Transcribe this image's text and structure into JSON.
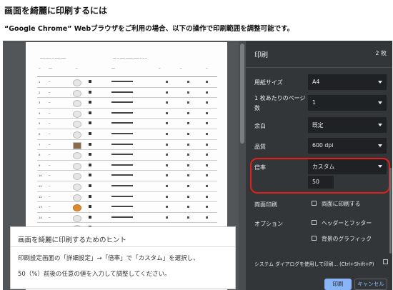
{
  "page": {
    "title": "画面を綺麗に印刷するには",
    "subtitle": "“Google Chrome” Webブラウザをご利用の場合、以下の操作で印刷範囲を調整可能です。"
  },
  "hint": {
    "title": "画面を綺麗に印刷するためのヒント",
    "line1": "印刷設定画面の「詳細設定」→「倍率」で「カスタム」を選択し、",
    "line2": "50（%）前後の任意の値を入力して調整してください。"
  },
  "print_panel": {
    "title": "印刷",
    "page_count": "2 枚",
    "settings": {
      "paper_size": {
        "label": "用紙サイズ",
        "value": "A4"
      },
      "pages_per_sheet": {
        "label_line1": "1 枚あたりのページ",
        "label_line2": "数",
        "value": "1"
      },
      "margins": {
        "label": "余白",
        "value": "既定"
      },
      "quality": {
        "label": "品質",
        "value": "600 dpi"
      },
      "scale": {
        "label": "倍率",
        "value": "カスタム",
        "custom_value": "50"
      },
      "two_sided": {
        "label": "両面印刷",
        "option": "両面に印刷する",
        "checked": false
      },
      "options": {
        "label": "オプション",
        "headers_footers": {
          "label": "ヘッダーとフッター",
          "checked": false
        },
        "background_graphics": {
          "label": "背景のグラフィック",
          "checked": false
        }
      }
    },
    "system_dialog_link": "システム ダイアログを使用して印刷... (Ctrl+Shift+P)",
    "buttons": {
      "print": "印刷",
      "cancel": "キャンセル"
    }
  },
  "colors": {
    "panel_bg": "#323639",
    "preview_bg": "#525659",
    "highlight": "#e0201c",
    "accent": "#8ab4f8"
  }
}
